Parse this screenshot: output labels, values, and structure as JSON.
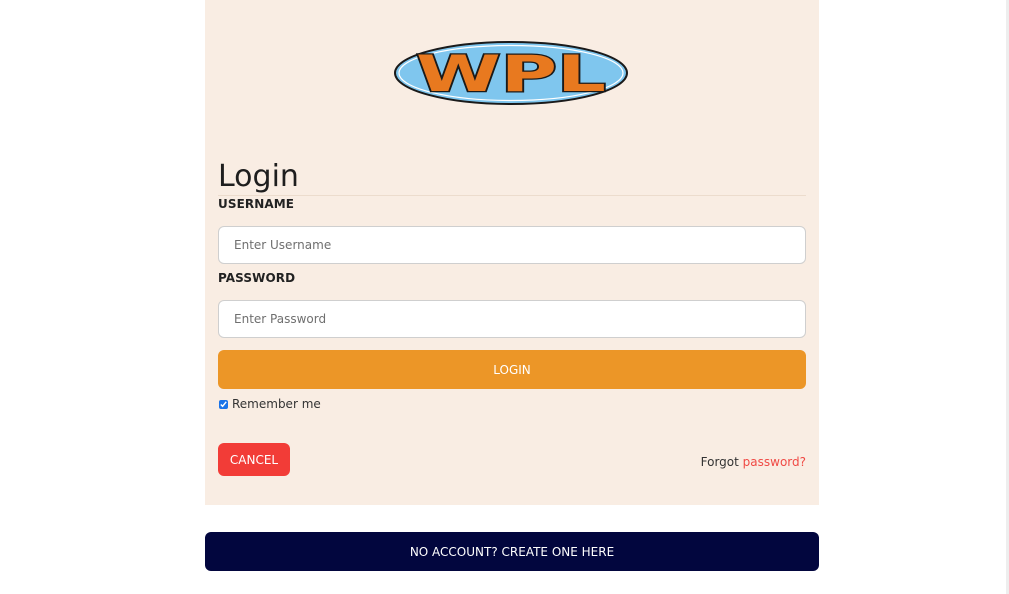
{
  "logo": {
    "text": "WPL"
  },
  "login": {
    "title": "Login",
    "username_label": "USERNAME",
    "username_placeholder": "Enter Username",
    "password_label": "PASSWORD",
    "password_placeholder": "Enter Password",
    "login_button": "LOGIN",
    "remember_label": "Remember me",
    "remember_checked": true,
    "cancel_button": "CANCEL",
    "forgot_prefix": "Forgot",
    "forgot_link": "password?"
  },
  "create_account": {
    "label": "NO ACCOUNT? CREATE ONE HERE"
  },
  "colors": {
    "panel_bg": "#f9ede3",
    "login_button": "#ec9627",
    "cancel_button": "#f23c37",
    "forgot_link": "#f04a45",
    "create_button": "#02063e",
    "logo_oval": "#7fc6ee",
    "logo_text": "#e8791f"
  }
}
